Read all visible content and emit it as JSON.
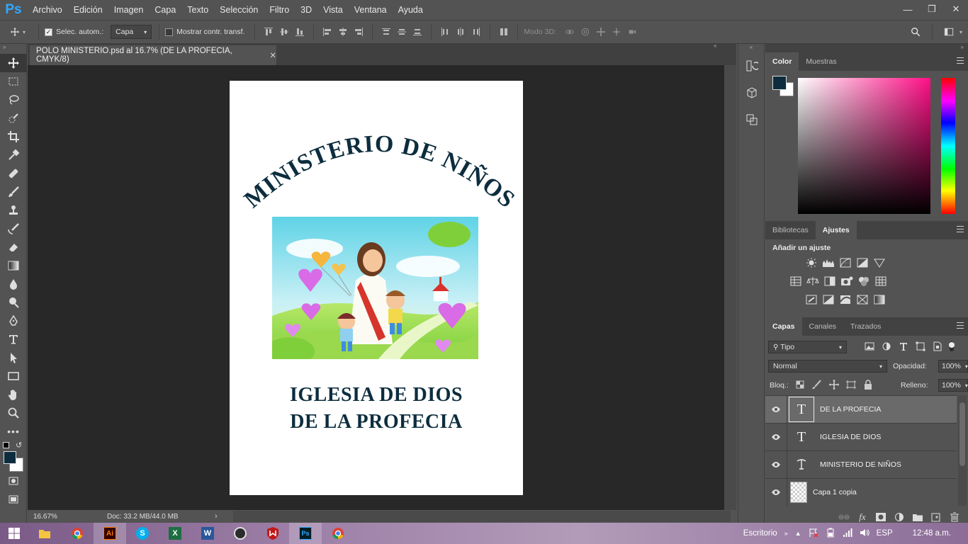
{
  "app": {
    "logo": "Ps"
  },
  "menu": [
    "Archivo",
    "Edición",
    "Imagen",
    "Capa",
    "Texto",
    "Selección",
    "Filtro",
    "3D",
    "Vista",
    "Ventana",
    "Ayuda"
  ],
  "options": {
    "auto_select_label": "Selec. autom.:",
    "auto_select_value": "Capa",
    "show_transform_label": "Mostrar contr. transf.",
    "mode3d_label": "Modo 3D:"
  },
  "document": {
    "tab_title": "POLO MINISTERIO.psd al 16.7% (DE LA PROFECIA, CMYK/8)",
    "zoom": "16.67%",
    "doc_size": "Doc: 33.2 MB/44.0 MB",
    "arc_text": "MINISTERIO DE NIÑOS",
    "line1": "IGLESIA DE DIOS",
    "line2": "DE LA PROFECIA"
  },
  "color_panel": {
    "tabs": [
      "Color",
      "Muestras"
    ],
    "fg": "#0d2d3e",
    "bg": "#ffffff"
  },
  "adjust_panel": {
    "tabs": [
      "Bibliotecas",
      "Ajustes"
    ],
    "heading": "Añadir un ajuste"
  },
  "layers_panel": {
    "tabs": [
      "Capas",
      "Canales",
      "Trazados"
    ],
    "filter": "Tipo",
    "blend": "Normal",
    "opacity_label": "Opacidad:",
    "opacity": "100%",
    "lock_label": "Bloq.:",
    "fill_label": "Relleno:",
    "fill": "100%",
    "layers": [
      {
        "name": "DE LA PROFECIA",
        "kind": "text"
      },
      {
        "name": "IGLESIA DE DIOS",
        "kind": "text"
      },
      {
        "name": "MINISTERIO DE NIÑOS",
        "kind": "warp-text"
      },
      {
        "name": "Capa 1 copia",
        "kind": "image"
      }
    ]
  },
  "taskbar": {
    "desktop_label": "Escritorio",
    "lang": "ESP",
    "time": "12:48 a.m."
  }
}
